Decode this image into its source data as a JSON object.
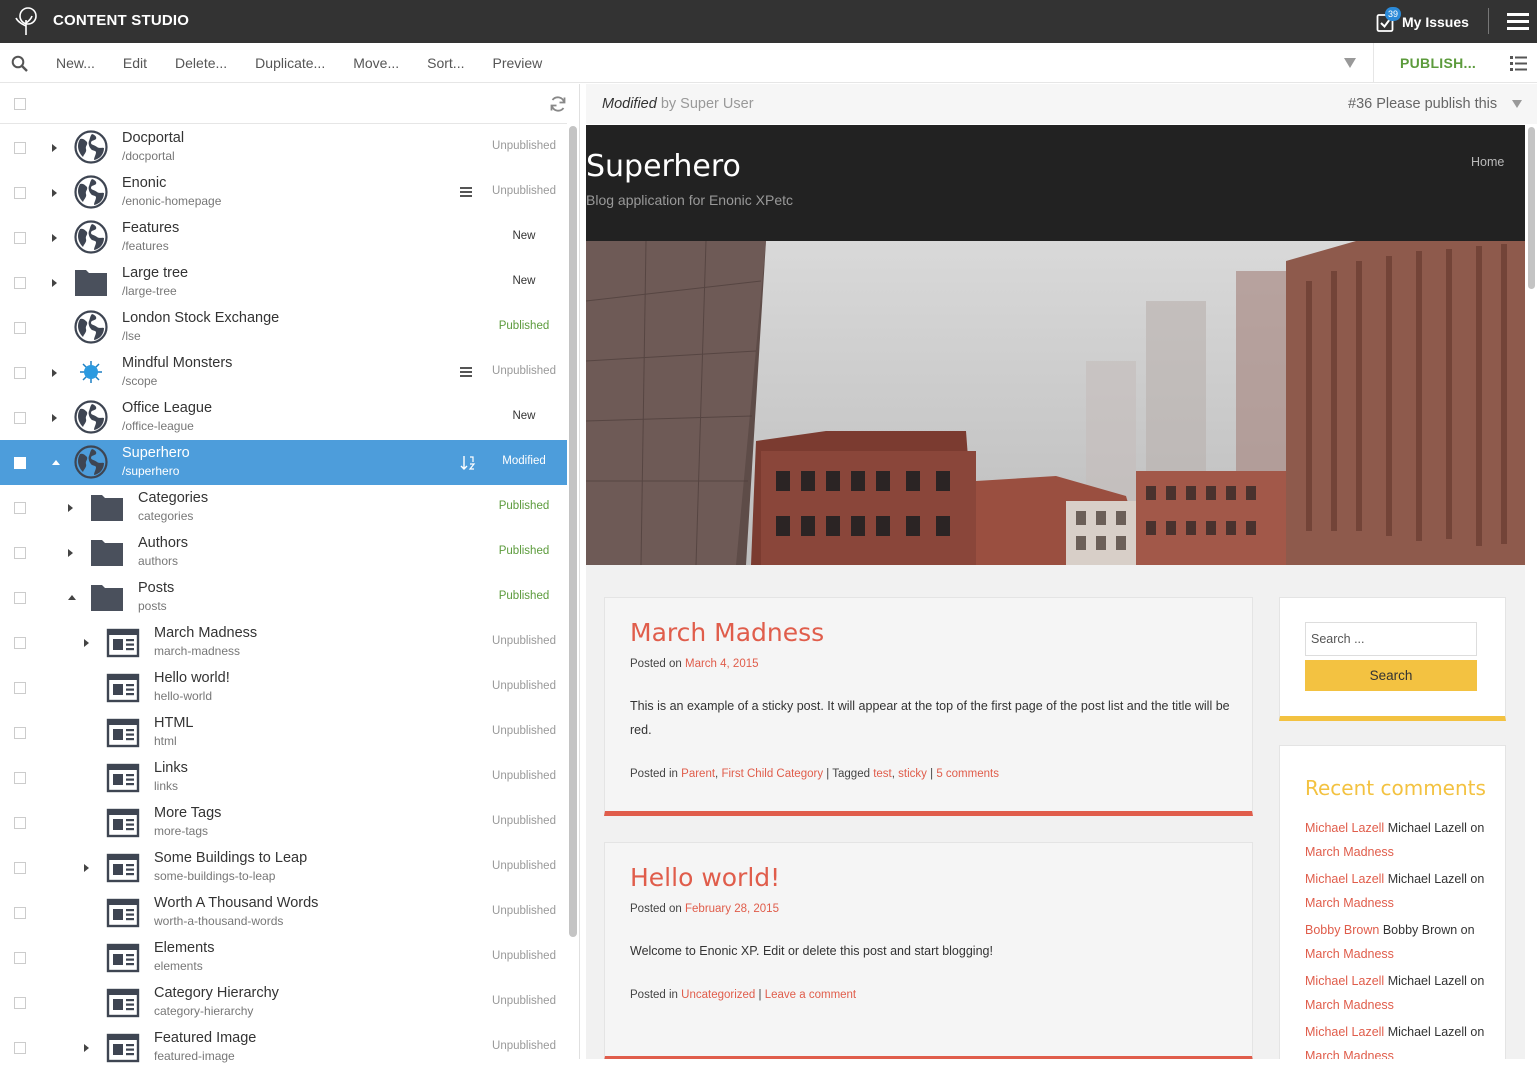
{
  "app": {
    "title": "CONTENT STUDIO"
  },
  "issues": {
    "label": "My Issues",
    "count": "39"
  },
  "toolbar": {
    "new": "New...",
    "edit": "Edit",
    "delete": "Delete...",
    "duplicate": "Duplicate...",
    "move": "Move...",
    "sort": "Sort...",
    "preview": "Preview",
    "publish": "PUBLISH..."
  },
  "tree": [
    {
      "name": "Docportal",
      "path": "/docportal",
      "status": "Unpublished",
      "icon": "globe-icon",
      "level": 0,
      "expander": "closed"
    },
    {
      "name": "Enonic",
      "path": "/enonic-homepage",
      "status": "Unpublished",
      "icon": "globe-icon",
      "level": 0,
      "expander": "closed",
      "mark": "list"
    },
    {
      "name": "Features",
      "path": "/features",
      "status": "New",
      "icon": "globe-icon",
      "level": 0,
      "expander": "closed"
    },
    {
      "name": "Large tree",
      "path": "/large-tree",
      "status": "New",
      "icon": "folder-icon",
      "level": 0,
      "expander": "closed"
    },
    {
      "name": "London Stock Exchange",
      "path": "/lse",
      "status": "Published",
      "icon": "globe-icon",
      "level": 0,
      "expander": "none"
    },
    {
      "name": "Mindful Monsters",
      "path": "/scope",
      "status": "Unpublished",
      "icon": "monster-icon",
      "level": 0,
      "expander": "closed",
      "mark": "list"
    },
    {
      "name": "Office League",
      "path": "/office-league",
      "status": "New",
      "icon": "globe-icon",
      "level": 0,
      "expander": "closed"
    },
    {
      "name": "Superhero",
      "path": "/superhero",
      "status": "Modified",
      "icon": "globe-icon",
      "level": 0,
      "expander": "open",
      "selected": true,
      "mark": "sort"
    },
    {
      "name": "Categories",
      "path": "categories",
      "status": "Published",
      "icon": "folder-icon",
      "level": 1,
      "expander": "closed"
    },
    {
      "name": "Authors",
      "path": "authors",
      "status": "Published",
      "icon": "folder-icon",
      "level": 1,
      "expander": "closed"
    },
    {
      "name": "Posts",
      "path": "posts",
      "status": "Published",
      "icon": "folder-icon",
      "level": 1,
      "expander": "open"
    },
    {
      "name": "March Madness",
      "path": "march-madness",
      "status": "Unpublished",
      "icon": "article-icon",
      "level": 2,
      "expander": "closed"
    },
    {
      "name": "Hello world!",
      "path": "hello-world",
      "status": "Unpublished",
      "icon": "article-icon",
      "level": 2,
      "expander": "none"
    },
    {
      "name": "HTML",
      "path": "html",
      "status": "Unpublished",
      "icon": "article-icon",
      "level": 2,
      "expander": "none"
    },
    {
      "name": "Links",
      "path": "links",
      "status": "Unpublished",
      "icon": "article-icon",
      "level": 2,
      "expander": "none"
    },
    {
      "name": "More Tags",
      "path": "more-tags",
      "status": "Unpublished",
      "icon": "article-icon",
      "level": 2,
      "expander": "none"
    },
    {
      "name": "Some Buildings to Leap",
      "path": "some-buildings-to-leap",
      "status": "Unpublished",
      "icon": "article-icon",
      "level": 2,
      "expander": "closed"
    },
    {
      "name": "Worth A Thousand Words",
      "path": "worth-a-thousand-words",
      "status": "Unpublished",
      "icon": "article-icon",
      "level": 2,
      "expander": "none"
    },
    {
      "name": "Elements",
      "path": "elements",
      "status": "Unpublished",
      "icon": "article-icon",
      "level": 2,
      "expander": "none"
    },
    {
      "name": "Category Hierarchy",
      "path": "category-hierarchy",
      "status": "Unpublished",
      "icon": "article-icon",
      "level": 2,
      "expander": "none"
    },
    {
      "name": "Featured Image",
      "path": "featured-image",
      "status": "Unpublished",
      "icon": "article-icon",
      "level": 2,
      "expander": "closed"
    }
  ],
  "preview_header": {
    "modified": "Modified",
    "by": "by Super User",
    "issue": "#36 Please publish this"
  },
  "site": {
    "title": "Superhero",
    "description": "Blog application for Enonic XPetc",
    "nav_home": "Home"
  },
  "posts": [
    {
      "title": "March Madness",
      "posted_on": "Posted on",
      "date": "March 4, 2015",
      "body": "This is an example of a sticky post. It will appear at the top of the first page of the post list and the title will be red.",
      "posted_in": "Posted in",
      "cat1": "Parent",
      "cat_sep": ",",
      "cat2": "First Child Category",
      "tagged": "| Tagged",
      "tag1": "test",
      "tag2": "sticky",
      "pipe": "|",
      "comments": "5 comments"
    },
    {
      "title": "Hello world!",
      "posted_on": "Posted on",
      "date": "February 28, 2015",
      "body": "Welcome to Enonic XP. Edit or delete this post and start blogging!",
      "posted_in": "Posted in",
      "cat1": "Uncategorized",
      "pipe": "|",
      "comments": "Leave a comment"
    }
  ],
  "sidebar": {
    "search_placeholder": "Search ...",
    "search_button": "Search",
    "recent_title": "Recent comments",
    "on": "on",
    "comments": [
      {
        "author_link": "Michael Lazell",
        "author": "Michael Lazell",
        "post": "March Madness"
      },
      {
        "author_link": "Michael Lazell",
        "author": "Michael Lazell",
        "post": "March Madness"
      },
      {
        "author_link": "Bobby Brown",
        "author": "Bobby Brown on",
        "post": "March Madness"
      },
      {
        "author_link": "Michael Lazell",
        "author": "Michael Lazell",
        "post": "March Madness"
      },
      {
        "author_link": "Michael Lazell",
        "author": "Michael Lazell",
        "post": "March Madness"
      }
    ]
  },
  "colors": {
    "appbar": "#333333",
    "selected": "#4d9ddb",
    "published": "#5c9b3c",
    "accent_red": "#e05d4b",
    "accent_yellow": "#f3c241"
  }
}
